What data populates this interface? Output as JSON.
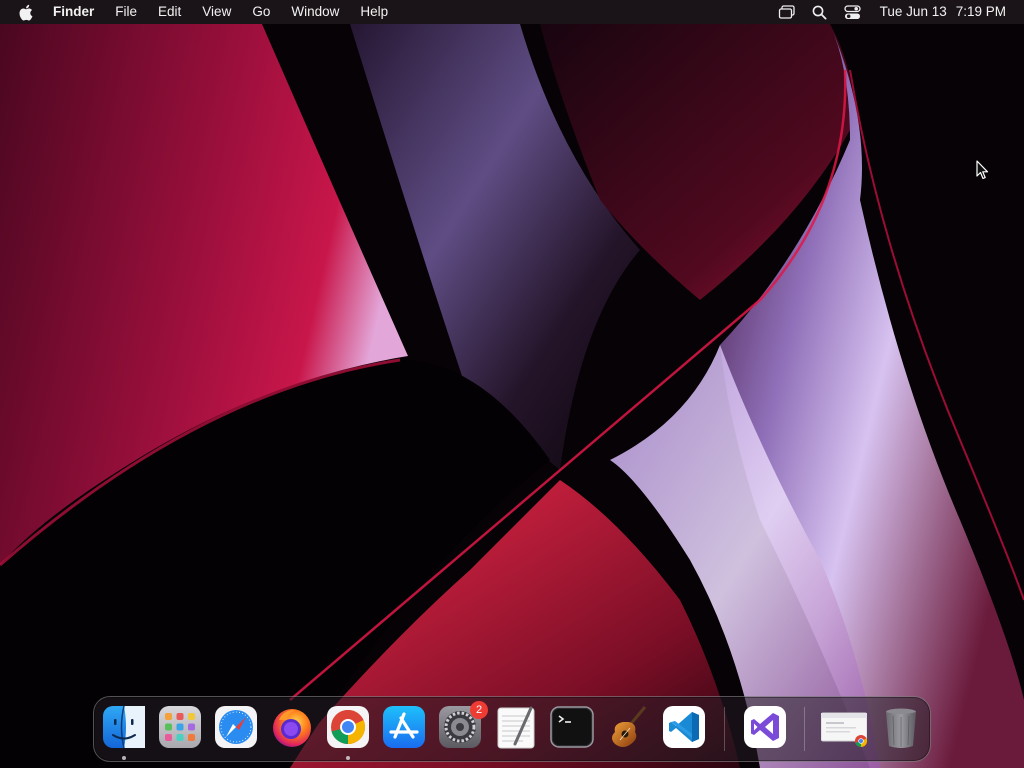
{
  "menubar": {
    "app_name": "Finder",
    "menus": [
      "File",
      "Edit",
      "View",
      "Go",
      "Window",
      "Help"
    ],
    "status_icons": [
      "screen-mirroring-icon",
      "spotlight-search-icon",
      "control-center-icon"
    ],
    "clock": {
      "date": "Tue Jun 13",
      "time": "7:19 PM"
    }
  },
  "dock": {
    "apps": [
      {
        "name": "Finder",
        "icon": "finder-icon",
        "running": true
      },
      {
        "name": "Launchpad",
        "icon": "launchpad-icon",
        "running": false
      },
      {
        "name": "Safari",
        "icon": "safari-icon",
        "running": false
      },
      {
        "name": "Firefox",
        "icon": "firefox-icon",
        "running": false
      },
      {
        "name": "Google Chrome",
        "icon": "chrome-icon",
        "running": true
      },
      {
        "name": "App Store",
        "icon": "app-store-icon",
        "running": false
      },
      {
        "name": "System Preferences",
        "icon": "system-preferences-icon",
        "running": false,
        "badge": "2"
      },
      {
        "name": "TextEdit",
        "icon": "textedit-icon",
        "running": false
      },
      {
        "name": "Terminal",
        "icon": "terminal-icon",
        "running": false
      },
      {
        "name": "GarageBand",
        "icon": "garageband-icon",
        "running": false
      },
      {
        "name": "Visual Studio Code",
        "icon": "vscode-icon",
        "running": false
      },
      {
        "name": "Visual Studio",
        "icon": "visual-studio-icon",
        "running": false
      },
      {
        "name": "Chrome Window",
        "icon": "chrome-window-thumbnail-icon",
        "running": false
      },
      {
        "name": "Trash",
        "icon": "trash-icon",
        "running": false
      }
    ]
  },
  "colors": {
    "menubar_bg": "#1c161a",
    "wallpaper_red": "#b0103e",
    "wallpaper_lavender": "#c9b0e8",
    "badge_red": "#ee3b34"
  }
}
